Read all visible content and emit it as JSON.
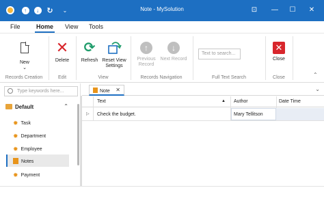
{
  "titlebar": {
    "title": "Note - MySolution",
    "quick_access": [
      "app-logo",
      "info-icon",
      "save-icon",
      "refresh-icon",
      "customize-icon"
    ],
    "window_controls": {
      "settings": "⊡",
      "minimize": "—",
      "maximize": "☐",
      "close": "✕"
    }
  },
  "ribbon_tabs": [
    "File",
    "Home",
    "View",
    "Tools"
  ],
  "ribbon": {
    "new_label": "New",
    "new_arrow": "⌄",
    "delete_label": "Delete",
    "refresh_label": "Refresh",
    "reset_label_1": "Reset View",
    "reset_label_2": "Settings",
    "prev_label_1": "Previous",
    "prev_label_2": "Record",
    "next_label": "Next Record",
    "search_placeholder": "Text to search...",
    "close_label": "Close",
    "groups": {
      "records_creation": "Records Creation",
      "edit": "Edit",
      "view": "View",
      "records_navigation": "Records Navigation",
      "full_text_search": "Full Text Search",
      "close": "Close"
    }
  },
  "sidebar": {
    "search_placeholder": "Type keywords here...",
    "group": "Default",
    "items": [
      {
        "label": "Task"
      },
      {
        "label": "Department"
      },
      {
        "label": "Employee"
      },
      {
        "label": "Notes"
      },
      {
        "label": "Payment"
      }
    ],
    "selected": "Notes"
  },
  "document": {
    "tab_label": "Note",
    "columns": [
      "Text",
      "Author",
      "Date Time"
    ],
    "rows": [
      {
        "text": "Check the budget.",
        "author": "Mary Tellitson",
        "date_time": ""
      }
    ]
  },
  "colors": {
    "accent": "#1d6fc2",
    "delete": "#d8262c",
    "refresh": "#1f9c6b",
    "nav_icon": "#e8941b"
  }
}
